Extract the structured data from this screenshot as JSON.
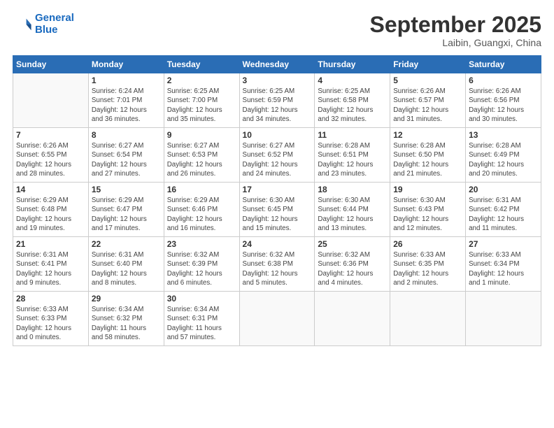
{
  "header": {
    "logo_line1": "General",
    "logo_line2": "Blue",
    "main_title": "September 2025",
    "subtitle": "Laibin, Guangxi, China"
  },
  "weekdays": [
    "Sunday",
    "Monday",
    "Tuesday",
    "Wednesday",
    "Thursday",
    "Friday",
    "Saturday"
  ],
  "weeks": [
    [
      {
        "day": "",
        "info": ""
      },
      {
        "day": "1",
        "info": "Sunrise: 6:24 AM\nSunset: 7:01 PM\nDaylight: 12 hours\nand 36 minutes."
      },
      {
        "day": "2",
        "info": "Sunrise: 6:25 AM\nSunset: 7:00 PM\nDaylight: 12 hours\nand 35 minutes."
      },
      {
        "day": "3",
        "info": "Sunrise: 6:25 AM\nSunset: 6:59 PM\nDaylight: 12 hours\nand 34 minutes."
      },
      {
        "day": "4",
        "info": "Sunrise: 6:25 AM\nSunset: 6:58 PM\nDaylight: 12 hours\nand 32 minutes."
      },
      {
        "day": "5",
        "info": "Sunrise: 6:26 AM\nSunset: 6:57 PM\nDaylight: 12 hours\nand 31 minutes."
      },
      {
        "day": "6",
        "info": "Sunrise: 6:26 AM\nSunset: 6:56 PM\nDaylight: 12 hours\nand 30 minutes."
      }
    ],
    [
      {
        "day": "7",
        "info": "Sunrise: 6:26 AM\nSunset: 6:55 PM\nDaylight: 12 hours\nand 28 minutes."
      },
      {
        "day": "8",
        "info": "Sunrise: 6:27 AM\nSunset: 6:54 PM\nDaylight: 12 hours\nand 27 minutes."
      },
      {
        "day": "9",
        "info": "Sunrise: 6:27 AM\nSunset: 6:53 PM\nDaylight: 12 hours\nand 26 minutes."
      },
      {
        "day": "10",
        "info": "Sunrise: 6:27 AM\nSunset: 6:52 PM\nDaylight: 12 hours\nand 24 minutes."
      },
      {
        "day": "11",
        "info": "Sunrise: 6:28 AM\nSunset: 6:51 PM\nDaylight: 12 hours\nand 23 minutes."
      },
      {
        "day": "12",
        "info": "Sunrise: 6:28 AM\nSunset: 6:50 PM\nDaylight: 12 hours\nand 21 minutes."
      },
      {
        "day": "13",
        "info": "Sunrise: 6:28 AM\nSunset: 6:49 PM\nDaylight: 12 hours\nand 20 minutes."
      }
    ],
    [
      {
        "day": "14",
        "info": "Sunrise: 6:29 AM\nSunset: 6:48 PM\nDaylight: 12 hours\nand 19 minutes."
      },
      {
        "day": "15",
        "info": "Sunrise: 6:29 AM\nSunset: 6:47 PM\nDaylight: 12 hours\nand 17 minutes."
      },
      {
        "day": "16",
        "info": "Sunrise: 6:29 AM\nSunset: 6:46 PM\nDaylight: 12 hours\nand 16 minutes."
      },
      {
        "day": "17",
        "info": "Sunrise: 6:30 AM\nSunset: 6:45 PM\nDaylight: 12 hours\nand 15 minutes."
      },
      {
        "day": "18",
        "info": "Sunrise: 6:30 AM\nSunset: 6:44 PM\nDaylight: 12 hours\nand 13 minutes."
      },
      {
        "day": "19",
        "info": "Sunrise: 6:30 AM\nSunset: 6:43 PM\nDaylight: 12 hours\nand 12 minutes."
      },
      {
        "day": "20",
        "info": "Sunrise: 6:31 AM\nSunset: 6:42 PM\nDaylight: 12 hours\nand 11 minutes."
      }
    ],
    [
      {
        "day": "21",
        "info": "Sunrise: 6:31 AM\nSunset: 6:41 PM\nDaylight: 12 hours\nand 9 minutes."
      },
      {
        "day": "22",
        "info": "Sunrise: 6:31 AM\nSunset: 6:40 PM\nDaylight: 12 hours\nand 8 minutes."
      },
      {
        "day": "23",
        "info": "Sunrise: 6:32 AM\nSunset: 6:39 PM\nDaylight: 12 hours\nand 6 minutes."
      },
      {
        "day": "24",
        "info": "Sunrise: 6:32 AM\nSunset: 6:38 PM\nDaylight: 12 hours\nand 5 minutes."
      },
      {
        "day": "25",
        "info": "Sunrise: 6:32 AM\nSunset: 6:36 PM\nDaylight: 12 hours\nand 4 minutes."
      },
      {
        "day": "26",
        "info": "Sunrise: 6:33 AM\nSunset: 6:35 PM\nDaylight: 12 hours\nand 2 minutes."
      },
      {
        "day": "27",
        "info": "Sunrise: 6:33 AM\nSunset: 6:34 PM\nDaylight: 12 hours\nand 1 minute."
      }
    ],
    [
      {
        "day": "28",
        "info": "Sunrise: 6:33 AM\nSunset: 6:33 PM\nDaylight: 12 hours\nand 0 minutes."
      },
      {
        "day": "29",
        "info": "Sunrise: 6:34 AM\nSunset: 6:32 PM\nDaylight: 11 hours\nand 58 minutes."
      },
      {
        "day": "30",
        "info": "Sunrise: 6:34 AM\nSunset: 6:31 PM\nDaylight: 11 hours\nand 57 minutes."
      },
      {
        "day": "",
        "info": ""
      },
      {
        "day": "",
        "info": ""
      },
      {
        "day": "",
        "info": ""
      },
      {
        "day": "",
        "info": ""
      }
    ]
  ]
}
